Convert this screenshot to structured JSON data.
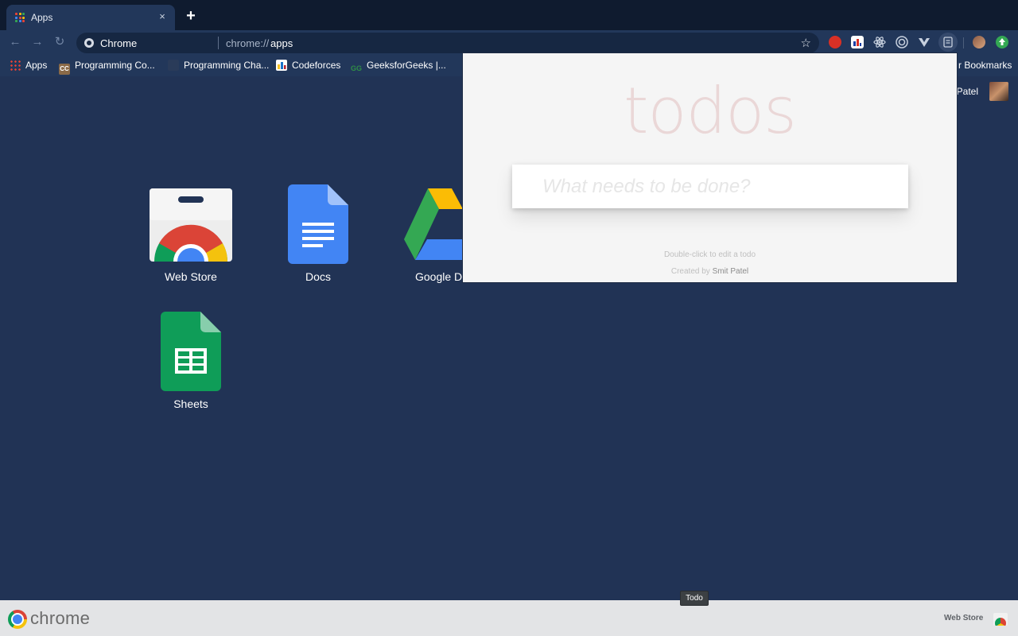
{
  "browser": {
    "tab": {
      "title": "Apps",
      "close": "×"
    },
    "new_tab": "+",
    "address": {
      "chip": "Chrome",
      "scheme": "chrome://",
      "host": "apps"
    },
    "nav": {
      "back": "←",
      "forward": "→",
      "reload": "↻"
    },
    "star": "☆",
    "extensions": [
      "ublock-icon",
      "chart-extension-icon",
      "react-devtools-icon",
      "target-extension-icon",
      "vue-devtools-icon",
      "todo-extension-icon",
      "profile-avatar-icon",
      "update-icon"
    ]
  },
  "bookmarks": {
    "items": [
      {
        "label": "Apps",
        "icon": "apps-grid-icon"
      },
      {
        "label": "Programming Co...",
        "icon": "cc-icon"
      },
      {
        "label": "Programming Cha...",
        "icon": "codechef-icon"
      },
      {
        "label": "Codeforces",
        "icon": "codeforces-icon"
      },
      {
        "label": "GeeksforGeeks |...",
        "icon": "gfg-icon"
      }
    ],
    "other": "r Bookmarks"
  },
  "page": {
    "profile_name": "t Patel",
    "apps": [
      {
        "label": "Web Store",
        "icon": "web-store-icon"
      },
      {
        "label": "Docs",
        "icon": "docs-icon"
      },
      {
        "label": "Google Dr",
        "icon": "google-drive-icon"
      },
      {
        "label": "Sheets",
        "icon": "sheets-icon"
      }
    ]
  },
  "todo_popup": {
    "title": "todos",
    "input_placeholder": "What needs to be done?",
    "info_edit": "Double-click to edit a todo",
    "info_created": "Created by",
    "info_author": "Smit Patel"
  },
  "bottom_bar": {
    "brand": "chrome",
    "webstore_label": "Web Store",
    "tooltip": "Todo"
  }
}
